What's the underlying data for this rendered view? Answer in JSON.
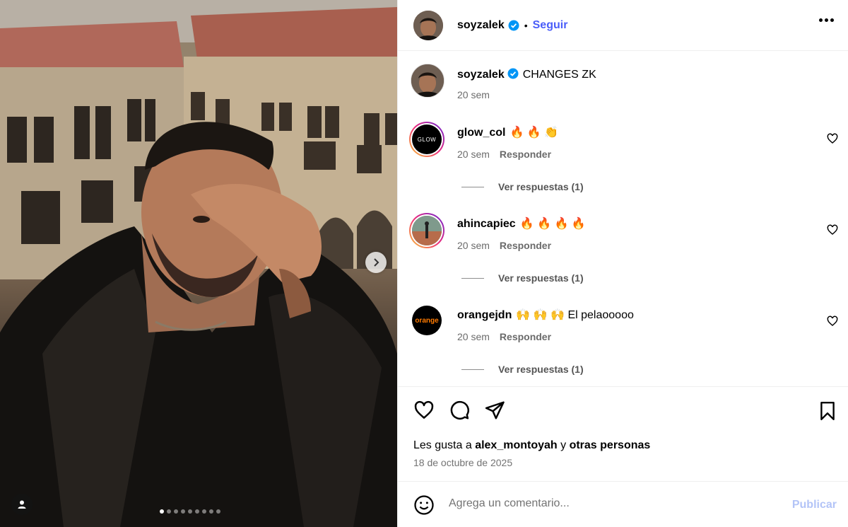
{
  "post": {
    "author": "soyzalek",
    "follow_label": "Seguir",
    "separator": "•",
    "caption": "CHANGES ZK",
    "caption_time": "20 sem",
    "carousel_pages": 9,
    "carousel_current": 1
  },
  "comments": [
    {
      "user": "glow_col",
      "text": "🔥 🔥 👏",
      "time": "20 sem",
      "reply_label": "Responder",
      "view_replies": "Ver respuestas (1)",
      "avatar_text": "GLOW"
    },
    {
      "user": "ahincapiec",
      "text": "🔥 🔥 🔥 🔥",
      "time": "20 sem",
      "reply_label": "Responder",
      "view_replies": "Ver respuestas (1)"
    },
    {
      "user": "orangejdn",
      "text": "🙌 🙌 🙌  El pelaooooo",
      "time": "20 sem",
      "reply_label": "Responder",
      "view_replies": "Ver respuestas (1)",
      "avatar_text": "orange"
    }
  ],
  "likes": {
    "prefix": "Les gusta a",
    "user": "alex_montoyah",
    "conj": "y",
    "others": "otras personas"
  },
  "date": "18 de octubre de 2025",
  "composer": {
    "placeholder": "Agrega un comentario...",
    "publish": "Publicar"
  },
  "colors": {
    "link": "#4a5df9",
    "verified": "#0095f6",
    "publish_disabled": "#b3c4f7"
  }
}
